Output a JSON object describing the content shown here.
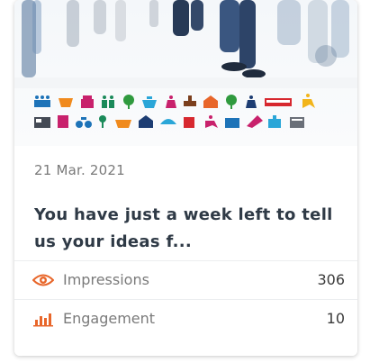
{
  "card": {
    "date": "21 Mar. 2021",
    "title": "You have just a week left to tell us your ideas f...",
    "stats": [
      {
        "icon": "eye-icon",
        "label": "Impressions",
        "value": "306"
      },
      {
        "icon": "bar-chart-icon",
        "label": "Engagement",
        "value": "10"
      }
    ]
  },
  "colors": {
    "accent": "#e8662a",
    "title": "#2f3a46",
    "muted": "#7a7a7a"
  }
}
